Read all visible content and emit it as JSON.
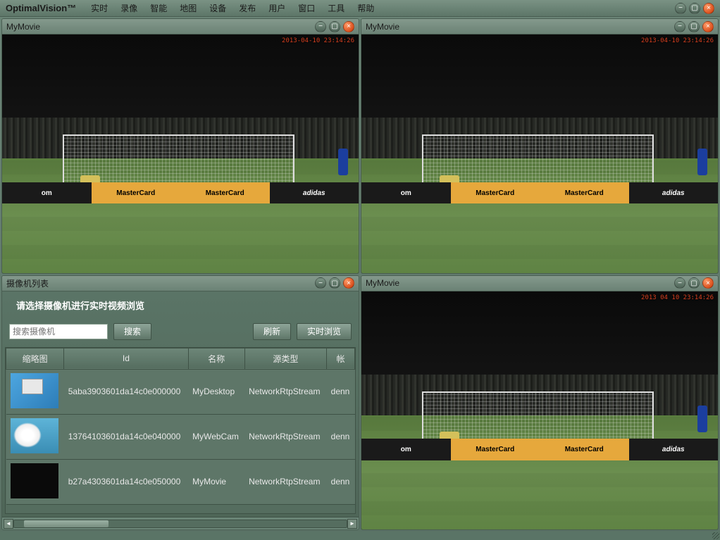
{
  "app": {
    "title": "OptimalVision™"
  },
  "menu": {
    "items": [
      "实时",
      "录像",
      "智能",
      "地图",
      "设备",
      "发布",
      "用户",
      "窗口",
      "工具",
      "帮助"
    ]
  },
  "video_panels": [
    {
      "title": "MyMovie",
      "timestamp": "2013-04-10 23:14:26"
    },
    {
      "title": "MyMovie",
      "timestamp": "2013-04-10 23:14:26"
    },
    {
      "title": "MyMovie",
      "timestamp": "2013 04 10 23:14:26"
    }
  ],
  "ads": {
    "a1": "om",
    "a2": "MasterCard",
    "a3": "adidas"
  },
  "camera_panel": {
    "title": "摄像机列表",
    "prompt": "请选择摄像机进行实时视频浏览",
    "search_placeholder": "搜索摄像机",
    "search_btn": "搜索",
    "refresh_btn": "刷新",
    "live_btn": "实时浏览",
    "columns": [
      "缩略图",
      "Id",
      "名称",
      "源类型",
      "帐"
    ],
    "rows": [
      {
        "thumb": "desktop",
        "id": "5aba3903601da14c0e000000",
        "name": "MyDesktop",
        "source": "NetworkRtpStream",
        "acct": "denn"
      },
      {
        "thumb": "webcam",
        "id": "13764103601da14c0e040000",
        "name": "MyWebCam",
        "source": "NetworkRtpStream",
        "acct": "denn"
      },
      {
        "thumb": "movie",
        "id": "b27a4303601da14c0e050000",
        "name": "MyMovie",
        "source": "NetworkRtpStream",
        "acct": "denn"
      }
    ]
  }
}
